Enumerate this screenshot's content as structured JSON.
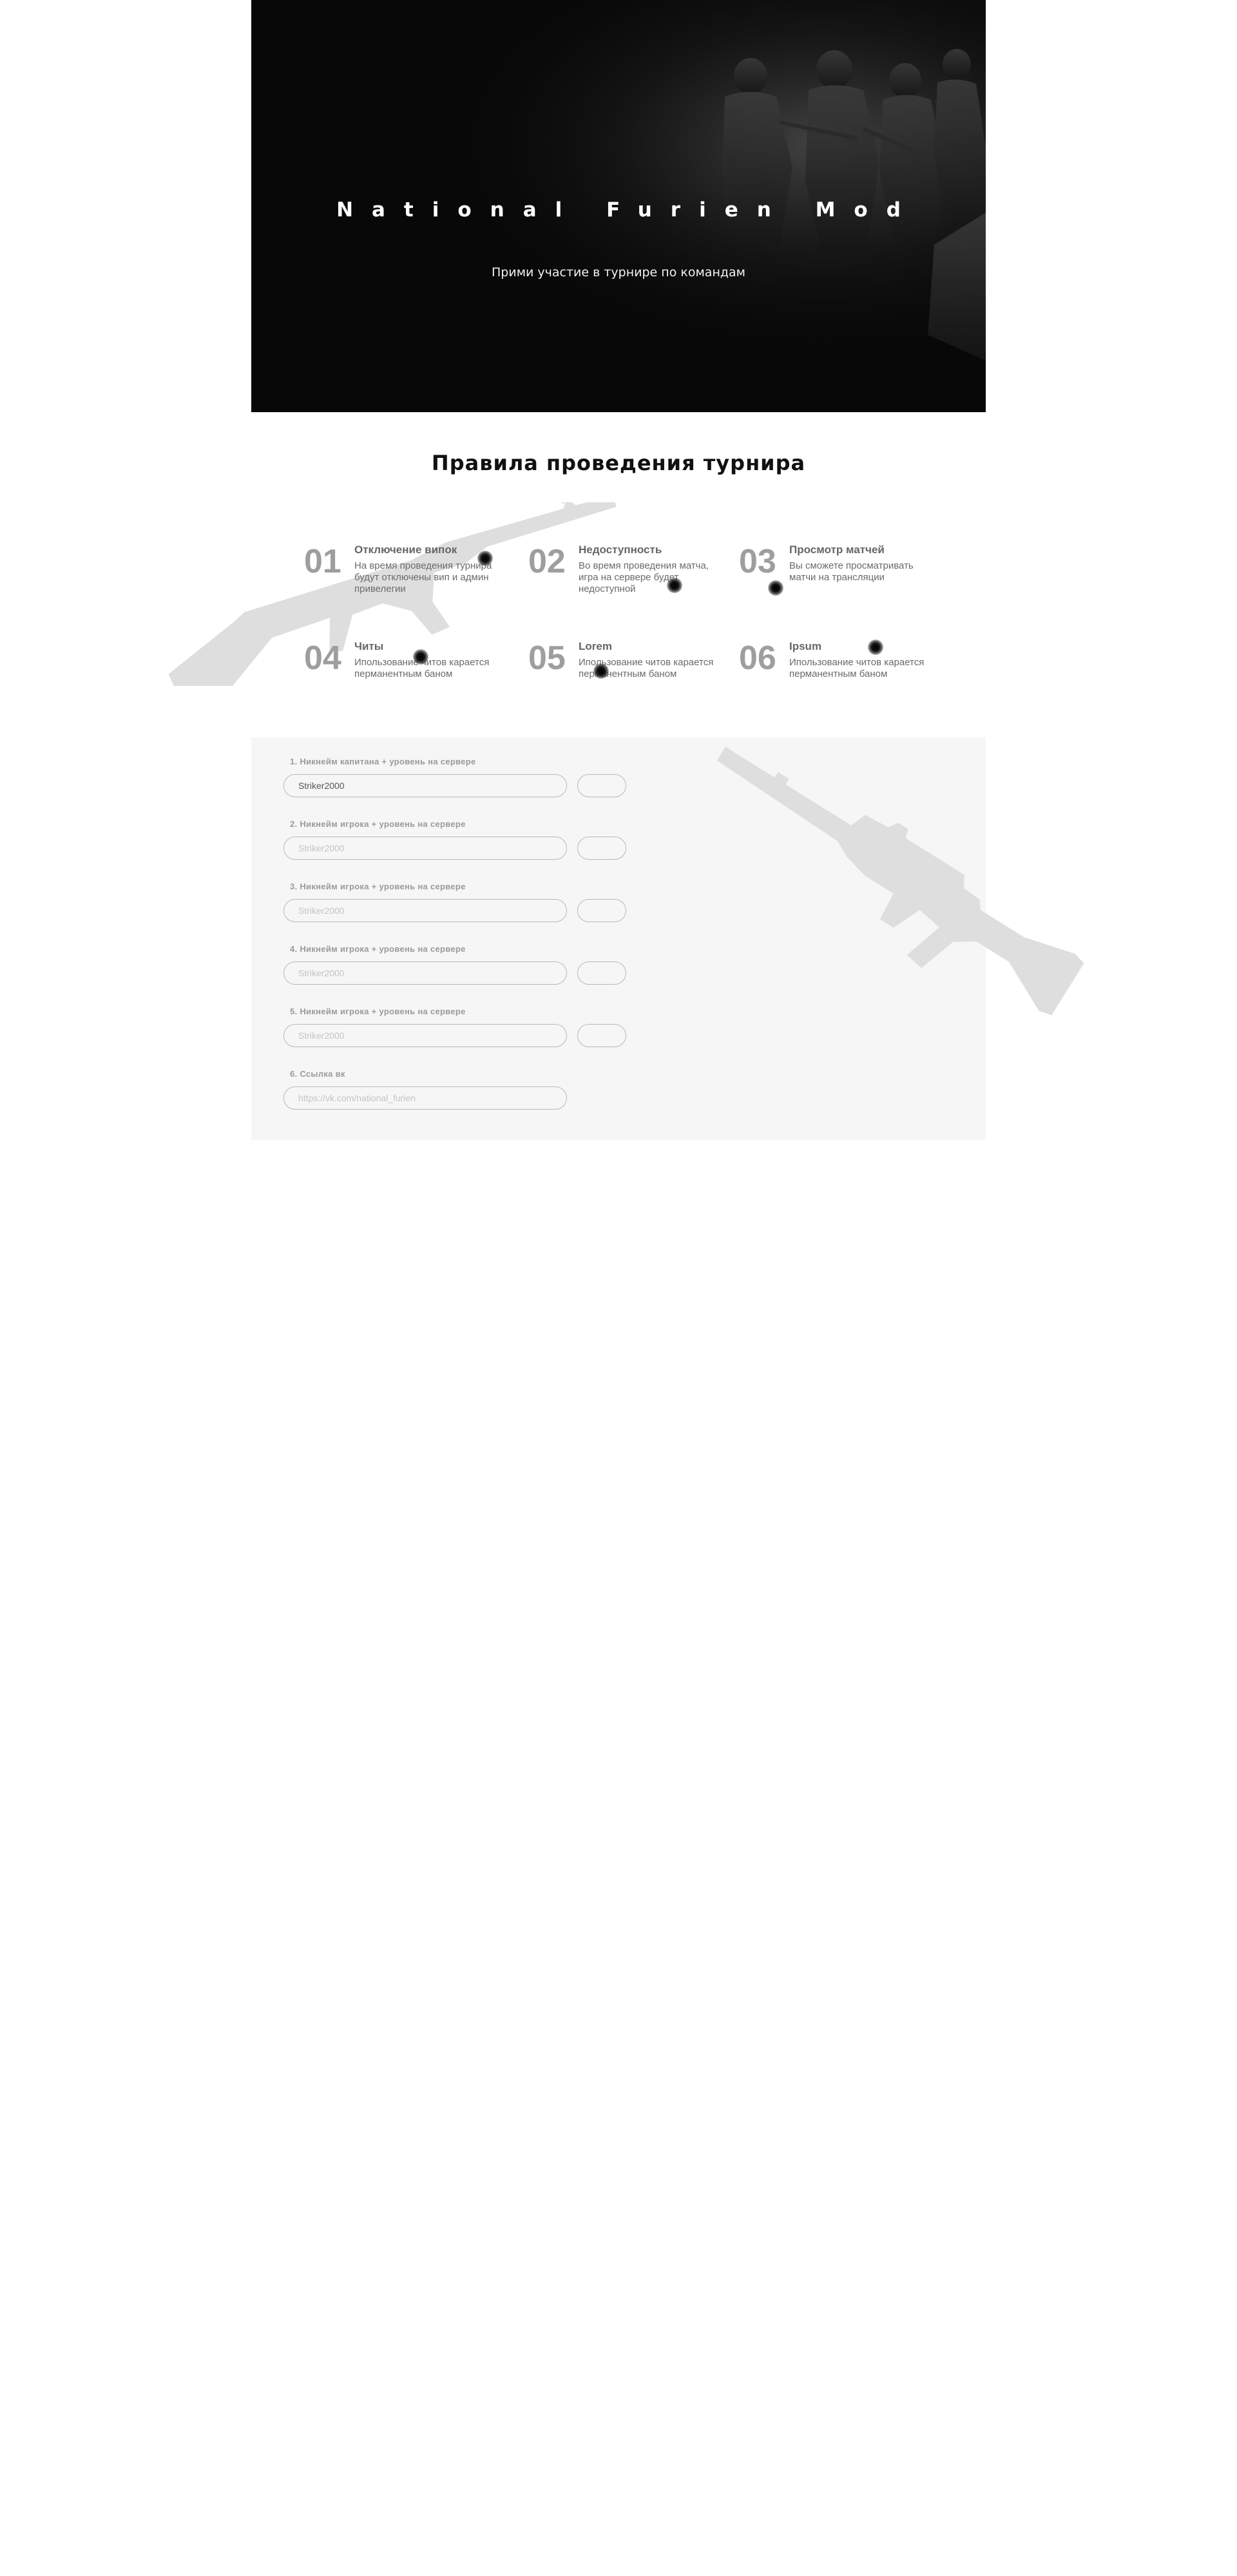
{
  "hero": {
    "title": "National Furien Mod",
    "subtitle": "Прими участие в турнире по командам"
  },
  "rules": {
    "heading": "Правила проведения турнира",
    "items": [
      {
        "number": "01",
        "title": "Отключение випок",
        "text": "На время проведения турнира будут отключены вип и админ привелегии"
      },
      {
        "number": "02",
        "title": "Недоступность",
        "text": "Во время проведения матча, игра на сервере будет недоступной"
      },
      {
        "number": "03",
        "title": "Просмотр матчей",
        "text": "Вы сможете просматривать матчи на трансляции"
      },
      {
        "number": "04",
        "title": "Читы",
        "text": "Ипользование читов карается перманентным баном"
      },
      {
        "number": "05",
        "title": "Lorem",
        "text": "Ипользование читов карается перманентным баном"
      },
      {
        "number": "06",
        "title": "Ipsum",
        "text": "Ипользование читов карается перманентным баном"
      }
    ]
  },
  "form": {
    "fields": [
      {
        "label": "1. Никнейм капитана + уровень на сервере",
        "value": "Striker2000",
        "placeholder": "Striker2000"
      },
      {
        "label": "2. Никнейм  игрока + уровень на сервере",
        "value": "",
        "placeholder": "Striker2000"
      },
      {
        "label": "3. Никнейм игрока + уровень на сервере",
        "value": "",
        "placeholder": "Striker2000"
      },
      {
        "label": "4. Никнейм игрока + уровень на сервере",
        "value": "",
        "placeholder": "Striker2000"
      },
      {
        "label": "5. Никнейм игрока + уровень на сервере",
        "value": "",
        "placeholder": "Striker2000"
      }
    ],
    "vk": {
      "label": "6. Ссылка вк",
      "value": "",
      "placeholder": "https://vk.com/national_furien"
    }
  },
  "colors": {
    "hero_bg": "#080808",
    "form_bg": "#f6f6f6",
    "rule_number": "#9e9e9e",
    "weapon_silhouette": "#dedede"
  },
  "icons": [
    "ak47-silhouette",
    "m4-rifle-silhouette",
    "bullet-hole-icon"
  ]
}
